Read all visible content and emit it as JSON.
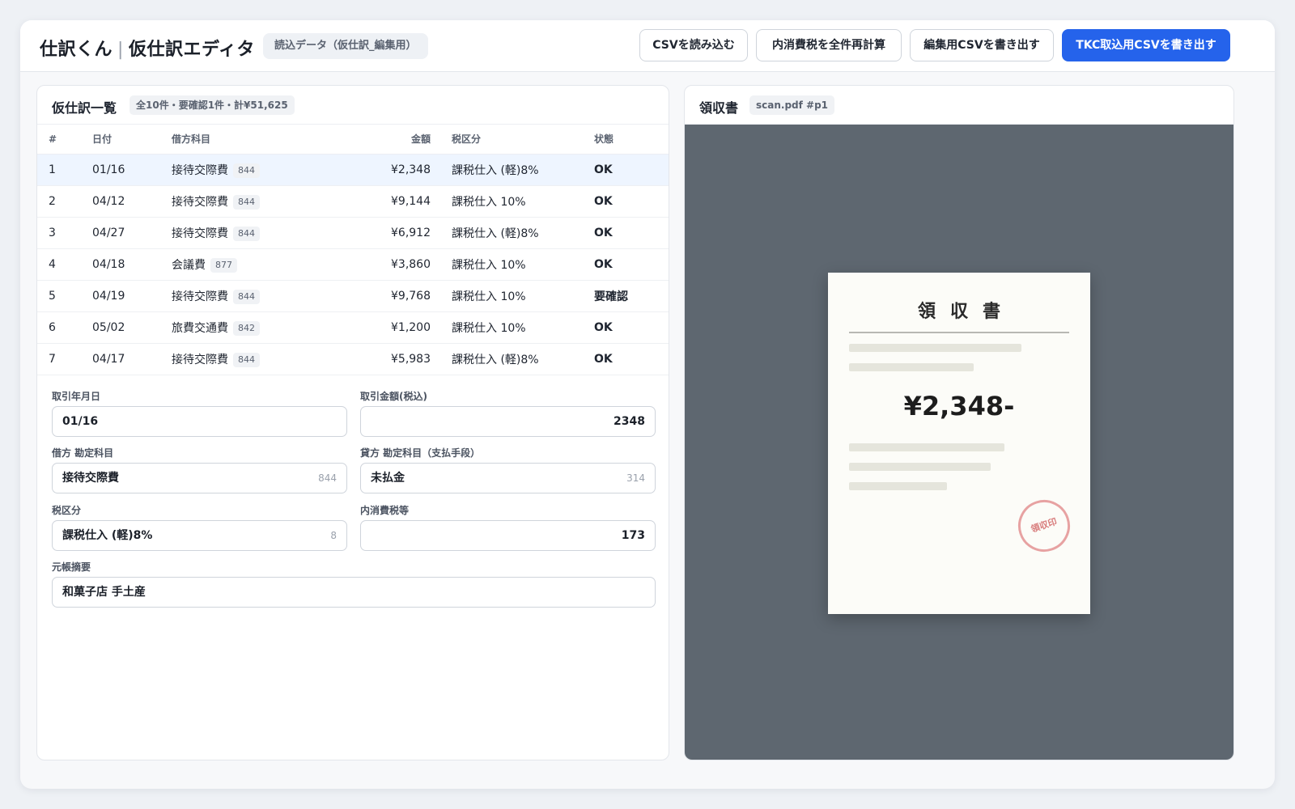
{
  "header": {
    "app_name": "仕訳くん",
    "separator": "|",
    "editor_name": "仮仕訳エディタ",
    "data_label": "読込データ（仮仕訳_編集用）",
    "buttons": {
      "import_csv": "CSVを読み込む",
      "recalc_tax": "内消費税を全件再計算",
      "export_edit_csv": "編集用CSVを書き出す",
      "export_tkc_csv": "TKC取込用CSVを書き出す"
    }
  },
  "list": {
    "title": "仮仕訳一覧",
    "summary": "全10件・要確認1件・計¥51,625",
    "columns": {
      "no": "#",
      "date": "日付",
      "debit": "借方科目",
      "amount": "金額",
      "tax": "税区分",
      "status": "状態"
    },
    "rows": [
      {
        "no": "1",
        "date": "01/16",
        "account": "接待交際費",
        "code": "844",
        "amount": "¥2,348",
        "tax": "課税仕入 (軽)8%",
        "status": "OK"
      },
      {
        "no": "2",
        "date": "04/12",
        "account": "接待交際費",
        "code": "844",
        "amount": "¥9,144",
        "tax": "課税仕入 10%",
        "status": "OK"
      },
      {
        "no": "3",
        "date": "04/27",
        "account": "接待交際費",
        "code": "844",
        "amount": "¥6,912",
        "tax": "課税仕入 (軽)8%",
        "status": "OK"
      },
      {
        "no": "4",
        "date": "04/18",
        "account": "会議費",
        "code": "877",
        "amount": "¥3,860",
        "tax": "課税仕入 10%",
        "status": "OK"
      },
      {
        "no": "5",
        "date": "04/19",
        "account": "接待交際費",
        "code": "844",
        "amount": "¥9,768",
        "tax": "課税仕入 10%",
        "status": "要確認"
      },
      {
        "no": "6",
        "date": "05/02",
        "account": "旅費交通費",
        "code": "842",
        "amount": "¥1,200",
        "tax": "課税仕入 10%",
        "status": "OK"
      },
      {
        "no": "7",
        "date": "04/17",
        "account": "接待交際費",
        "code": "844",
        "amount": "¥5,983",
        "tax": "課税仕入 (軽)8%",
        "status": "OK"
      }
    ]
  },
  "form": {
    "date_label": "取引年月日",
    "date_value": "01/16",
    "amount_label": "取引金額(税込)",
    "amount_value": "2348",
    "debit_label": "借方 勘定科目",
    "debit_value": "接待交際費",
    "debit_code": "844",
    "credit_label": "貸方 勘定科目（支払手段）",
    "credit_value": "未払金",
    "credit_code": "314",
    "tax_label": "税区分",
    "tax_value": "課税仕入 (軽)8%",
    "tax_code": "8",
    "inner_tax_label": "内消費税等",
    "inner_tax_value": "173",
    "memo_label": "元帳摘要",
    "memo_value": "和菓子店 手土産"
  },
  "receipt_panel": {
    "title": "領収書",
    "file": "scan.pdf #p1",
    "doc_title": "領収書",
    "amount": "¥2,348-",
    "stamp": "領収印"
  },
  "colors": {
    "primary": "#2563eb",
    "ok": "#0e9f6e",
    "warn": "#d97706",
    "selected_row": "#eef5ff",
    "viewer_bg": "#5e6770"
  }
}
